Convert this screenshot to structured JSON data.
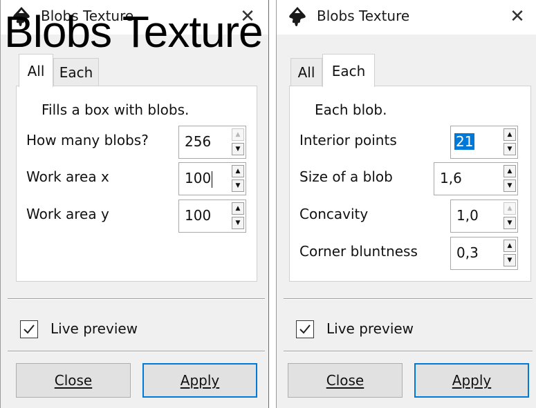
{
  "overlay_title": "Blobs Texture",
  "colors": {
    "selection": "#0078d7",
    "default_button_border": "#0078d7",
    "panel_bg": "#f0f0f0",
    "icon": "#1a1a1a"
  },
  "dialogs": [
    {
      "title": "Blobs Texture",
      "app_icon": "inkscape-icon",
      "close_label": "✕",
      "tabs": [
        {
          "label": "All",
          "active": true
        },
        {
          "label": "Each",
          "active": false
        }
      ],
      "panel": {
        "description": "Fills a box with blobs.",
        "fields": [
          {
            "label": "How many blobs?",
            "value": "256",
            "up_enabled": false,
            "down_enabled": true
          },
          {
            "label": "Work area x",
            "value": "100",
            "focused": true,
            "up_enabled": true,
            "down_enabled": true
          },
          {
            "label": "Work area y",
            "value": "100",
            "up_enabled": true,
            "down_enabled": true
          }
        ]
      },
      "live_preview": {
        "label": "Live preview",
        "checked": true
      },
      "buttons": {
        "close": "Close",
        "apply": "Apply"
      }
    },
    {
      "title": "Blobs Texture",
      "app_icon": "inkscape-icon",
      "close_label": "✕",
      "tabs": [
        {
          "label": "All",
          "active": false
        },
        {
          "label": "Each",
          "active": true
        }
      ],
      "panel": {
        "description": "Each blob.",
        "fields": [
          {
            "label": "Interior points",
            "value": "21",
            "selected": true,
            "up_enabled": true,
            "down_enabled": true
          },
          {
            "label": "Size of a blob",
            "value": "1,6",
            "up_enabled": true,
            "down_enabled": true
          },
          {
            "label": "Concavity",
            "value": "1,0",
            "up_enabled": false,
            "down_enabled": true
          },
          {
            "label": "Corner bluntness",
            "value": "0,3",
            "up_enabled": true,
            "down_enabled": true
          }
        ]
      },
      "live_preview": {
        "label": "Live preview",
        "checked": true
      },
      "buttons": {
        "close": "Close",
        "apply": "Apply"
      }
    }
  ]
}
